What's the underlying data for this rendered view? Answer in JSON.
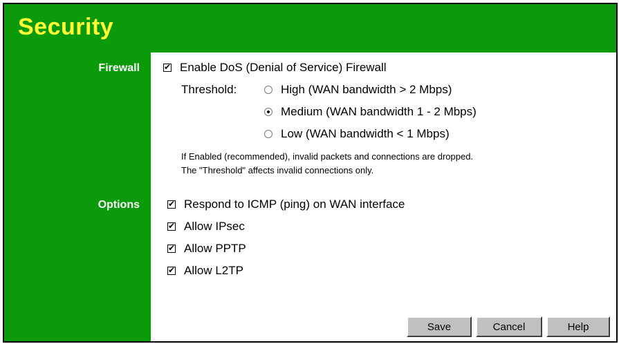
{
  "header": {
    "title": "Security"
  },
  "firewall": {
    "section_label": "Firewall",
    "enable_dos_label": "Enable DoS (Denial of Service) Firewall",
    "enable_dos_checked": true,
    "threshold_label": "Threshold:",
    "options": [
      {
        "label": "High (WAN bandwidth > 2 Mbps)",
        "selected": false
      },
      {
        "label": "Medium (WAN bandwidth 1 - 2 Mbps)",
        "selected": true
      },
      {
        "label": "Low (WAN bandwidth < 1 Mbps)",
        "selected": false
      }
    ],
    "note_line1": "If Enabled (recommended), invalid packets and connections are dropped.",
    "note_line2": "The \"Threshold\" affects invalid connections only."
  },
  "options": {
    "section_label": "Options",
    "items": [
      {
        "label": "Respond to ICMP (ping) on WAN interface",
        "checked": true
      },
      {
        "label": "Allow IPsec",
        "checked": true
      },
      {
        "label": "Allow PPTP",
        "checked": true
      },
      {
        "label": "Allow L2TP",
        "checked": true
      }
    ]
  },
  "buttons": {
    "save": "Save",
    "cancel": "Cancel",
    "help": "Help"
  },
  "colors": {
    "accent_green": "#0a9a0a",
    "title_yellow": "#ffff33"
  }
}
